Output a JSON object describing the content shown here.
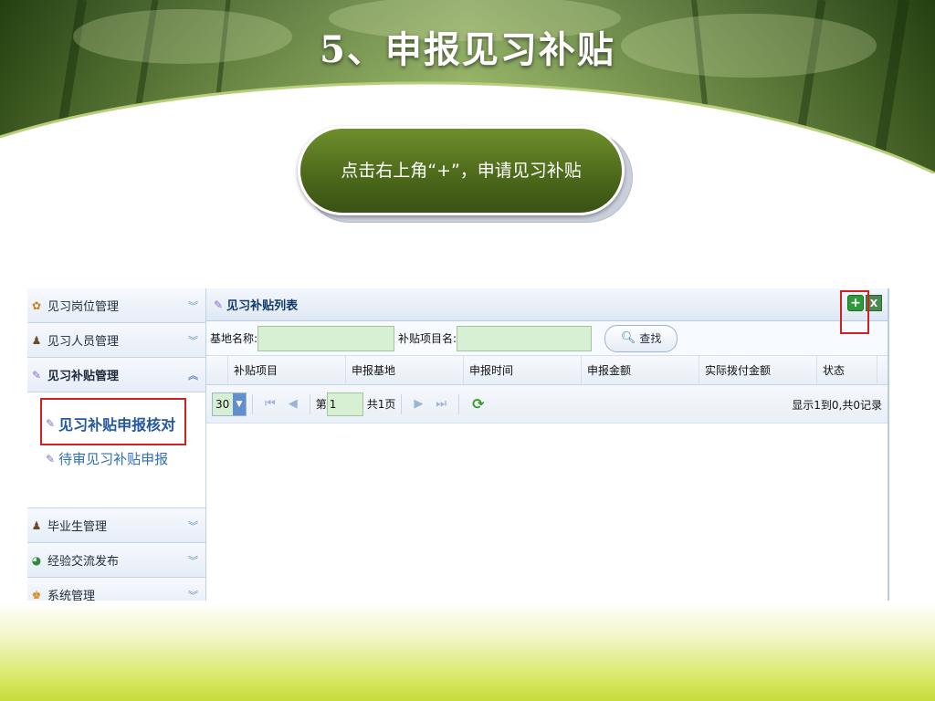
{
  "slide": {
    "title": "5、申报见习补贴",
    "callout": "点击右上角“+”，申请见习补贴"
  },
  "sidebar": {
    "groups": [
      {
        "label": "见习岗位管理",
        "icon": "job-post-icon"
      },
      {
        "label": "见习人员管理",
        "icon": "person-icon"
      },
      {
        "label": "见习补贴管理",
        "icon": "subsidy-icon",
        "active": true
      },
      {
        "label": "毕业生管理",
        "icon": "graduate-icon"
      },
      {
        "label": "经验交流发布",
        "icon": "exchange-icon"
      },
      {
        "label": "系统管理",
        "icon": "system-user-icon"
      }
    ],
    "sub_items": [
      {
        "label": "见习补贴申报核对",
        "icon": "subsidy-check-icon"
      },
      {
        "label": "待审见习补贴申报",
        "icon": "subsidy-pending-icon"
      }
    ]
  },
  "panel": {
    "title": "见习补贴列表",
    "tools": {
      "add": "+",
      "export": "X"
    }
  },
  "search": {
    "base_name_label": "基地名称:",
    "base_name_value": "",
    "item_name_label": "补贴项目名:",
    "item_name_value": "",
    "button_label": "查找"
  },
  "grid": {
    "columns": [
      "补贴项目",
      "申报基地",
      "申报时间",
      "申报金额",
      "实际拨付金额",
      "状态"
    ]
  },
  "pager": {
    "page_size": "30",
    "page_prefix": "第",
    "page_number": "1",
    "total_pages": "共1页",
    "info": "显示1到0,共0记录"
  },
  "colors": {
    "callout_green": "#4d6a1b",
    "highlight_red": "#d02020",
    "input_green": "#d7efd2"
  }
}
